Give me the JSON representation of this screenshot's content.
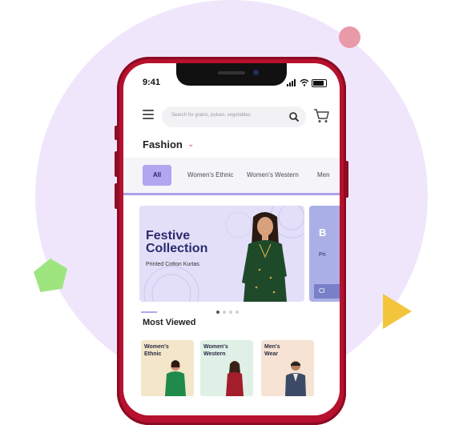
{
  "status": {
    "time": "9:41"
  },
  "search": {
    "placeholder": "Search for grains, pulses, vegetables"
  },
  "header": {
    "category": "Fashion"
  },
  "filters": [
    {
      "label": "All",
      "active": true
    },
    {
      "label": "Women's Ethnic",
      "active": false
    },
    {
      "label": "Women's Western",
      "active": false
    },
    {
      "label": "Men",
      "active": false
    }
  ],
  "banners": [
    {
      "title_line1": "Festive",
      "title_line2": "Collection",
      "subtitle": "Printed Cotton Kurtas"
    },
    {
      "title": "B",
      "subtitle": "Pri",
      "cta": "Cl"
    }
  ],
  "pager": {
    "pages": 4,
    "active": 1
  },
  "section": {
    "title": "Most Viewed"
  },
  "cards": [
    {
      "line1": "Women's",
      "line2": "Ethnic",
      "bg": "#f3e6c9"
    },
    {
      "line1": "Women's",
      "line2": "Western",
      "bg": "#dff0e6"
    },
    {
      "line1": "Men's",
      "line2": "Wear",
      "bg": "#f6e3d3"
    }
  ],
  "colors": {
    "accent": "#b3a6f0",
    "brand_dark": "#2b2a6e",
    "phone": "#b6112e",
    "chevron": "#e0506a"
  }
}
